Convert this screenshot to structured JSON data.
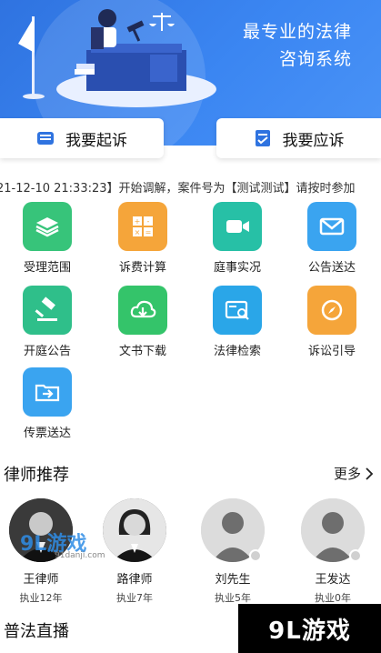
{
  "hero": {
    "slogan_line1": "最专业的法律",
    "slogan_line2": "咨询系统"
  },
  "actions": {
    "sue_label": "我要起诉",
    "respond_label": "我要应诉"
  },
  "notice": {
    "text": "21-12-10 21:33:23】开始调解，案件号为【测试测试】请按时参加"
  },
  "services": [
    {
      "label": "受理范围",
      "icon": "layers-icon",
      "color": "#37c47a"
    },
    {
      "label": "诉费计算",
      "icon": "calculator-icon",
      "color": "#f5a53a"
    },
    {
      "label": "庭事实况",
      "icon": "video-icon",
      "color": "#27c0a6"
    },
    {
      "label": "公告送达",
      "icon": "mail-icon",
      "color": "#3aa4f0"
    },
    {
      "label": "开庭公告",
      "icon": "gavel-icon",
      "color": "#2fbf8a"
    },
    {
      "label": "文书下载",
      "icon": "cloud-download-icon",
      "color": "#34c46a"
    },
    {
      "label": "法律检索",
      "icon": "search-card-icon",
      "color": "#2aa6e8"
    },
    {
      "label": "诉讼引导",
      "icon": "compass-icon",
      "color": "#f5a53a"
    },
    {
      "label": "传票送达",
      "icon": "folder-arrow-icon",
      "color": "#3aa4f0"
    }
  ],
  "lawyers_section": {
    "title": "律师推荐",
    "more_label": "更多"
  },
  "lawyers": [
    {
      "name": "王律师",
      "years": "执业12年"
    },
    {
      "name": "路律师",
      "years": "执业7年"
    },
    {
      "name": "刘先生",
      "years": "执业5年"
    },
    {
      "name": "王发达",
      "years": "执业0年"
    }
  ],
  "live_section": {
    "title": "普法直播"
  },
  "watermark": {
    "text": "9L游戏",
    "small_text": "9L游戏",
    "url": "91danji.com"
  }
}
